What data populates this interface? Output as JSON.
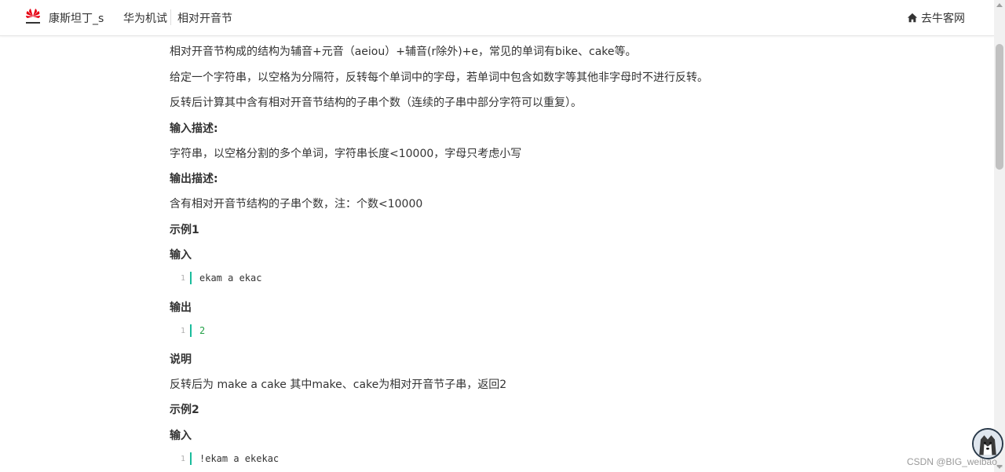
{
  "header": {
    "brand_icon": "huawei-logo-icon",
    "brand_text": "康斯坦丁_s",
    "nav": [
      "华为机试",
      "相对开音节"
    ],
    "home_link": "去牛客网",
    "home_icon": "home-icon"
  },
  "content": {
    "para1": "相对开音节构成的结构为辅音+元音（aeiou）+辅音(r除外)+e，常见的单词有bike、cake等。",
    "para2": "给定一个字符串，以空格为分隔符，反转每个单词中的字母，若单词中包含如数字等其他非字母时不进行反转。",
    "para3": "反转后计算其中含有相对开音节结构的子串个数（连续的子串中部分字符可以重复）。",
    "input_desc_title": "输入描述:",
    "input_desc": "字符串，以空格分割的多个单词，字符串长度<10000，字母只考虑小写",
    "output_desc_title": "输出描述:",
    "output_desc": "含有相对开音节结构的子串个数，注：个数<10000",
    "example1_title": "示例1",
    "example1_input_label": "输入",
    "example1_input_line": "1",
    "example1_input": "ekam a ekac",
    "example1_output_label": "输出",
    "example1_output_line": "1",
    "example1_output": "2",
    "explain_title": "说明",
    "explain": "反转后为 make a cake 其中make、cake为相对开音节子串，返回2",
    "example2_title": "示例2",
    "example2_input_label": "输入",
    "example2_input_line": "1",
    "example2_input": "!ekam a ekekac"
  },
  "watermark": "CSDN @BIG_weibao_",
  "colors": {
    "accent": "#1abc9c",
    "brand_red": "#e60012",
    "number_green": "#22a046"
  }
}
